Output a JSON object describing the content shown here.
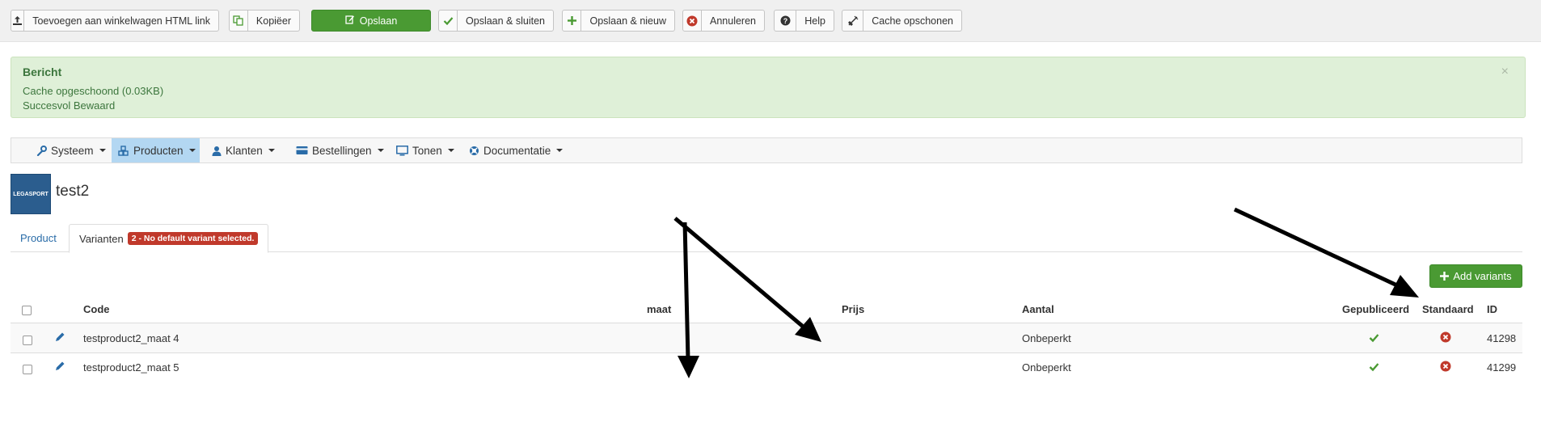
{
  "toolbar": {
    "add_to_cart": "Toevoegen aan winkelwagen HTML link",
    "copy": "Kopiëer",
    "save": "Opslaan",
    "save_close": "Opslaan & sluiten",
    "save_new": "Opslaan & nieuw",
    "cancel": "Annuleren",
    "help": "Help",
    "clear_cache": "Cache opschonen"
  },
  "message": {
    "heading": "Bericht",
    "line1": "Cache opgeschoond (0.03KB)",
    "line2": "Succesvol Bewaard",
    "close": "×"
  },
  "menu": {
    "items": [
      {
        "label": "Systeem",
        "icon": "wrench-icon"
      },
      {
        "label": "Producten",
        "icon": "cubes-icon",
        "active": true
      },
      {
        "label": "Klanten",
        "icon": "user-icon"
      },
      {
        "label": "Bestellingen",
        "icon": "credit-card-icon"
      },
      {
        "label": "Tonen",
        "icon": "monitor-icon"
      },
      {
        "label": "Documentatie",
        "icon": "life-ring-icon"
      }
    ]
  },
  "page": {
    "title": "test2",
    "logo_text": "LEGASPORT"
  },
  "tabs": {
    "product": "Product",
    "variants": "Varianten",
    "variants_badge": "2 - No default variant selected."
  },
  "add_variants": "Add variants",
  "table": {
    "headers": {
      "code": "Code",
      "size": "maat",
      "price": "Prijs",
      "quantity": "Aantal",
      "published": "Gepubliceerd",
      "default": "Standaard",
      "id": "ID"
    },
    "rows": [
      {
        "code": "testproduct2_maat 4",
        "size": "",
        "price": "",
        "quantity": "Onbeperkt",
        "published": true,
        "default": false,
        "id": "41298"
      },
      {
        "code": "testproduct2_maat 5",
        "size": "",
        "price": "",
        "quantity": "Onbeperkt",
        "published": true,
        "default": false,
        "id": "41299"
      }
    ]
  },
  "colors": {
    "success_green": "#4a9a33",
    "message_bg": "#dff0d8",
    "danger_red": "#c0392b",
    "link_blue": "#2a6ca8",
    "menu_active": "#b3d7f2"
  }
}
